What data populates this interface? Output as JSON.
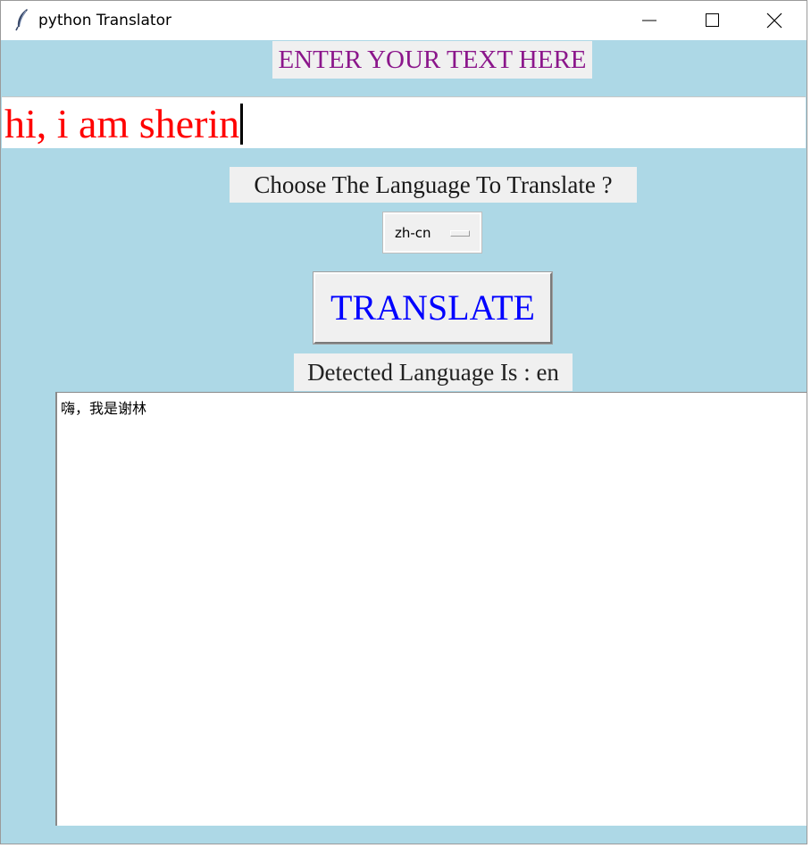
{
  "window": {
    "title": "python Translator",
    "icon": "feather-icon",
    "controls": [
      "minimize-icon",
      "maximize-icon",
      "close-icon"
    ]
  },
  "heading": {
    "text": "ENTER YOUR TEXT HERE",
    "color": "#8b168b"
  },
  "input": {
    "value": "hi, i am sherin",
    "color": "#ff0000"
  },
  "prompt": {
    "text": "Choose The Language  To Translate ?"
  },
  "language_select": {
    "value": "zh-cn"
  },
  "translate_button": {
    "label": "TRANSLATE",
    "color": "#0000ff"
  },
  "detected": {
    "text": "Detected Language Is : en"
  },
  "output": {
    "text": "嗨，我是谢林"
  },
  "colors": {
    "background": "#add8e6",
    "label_bg": "#f0f0f0"
  }
}
